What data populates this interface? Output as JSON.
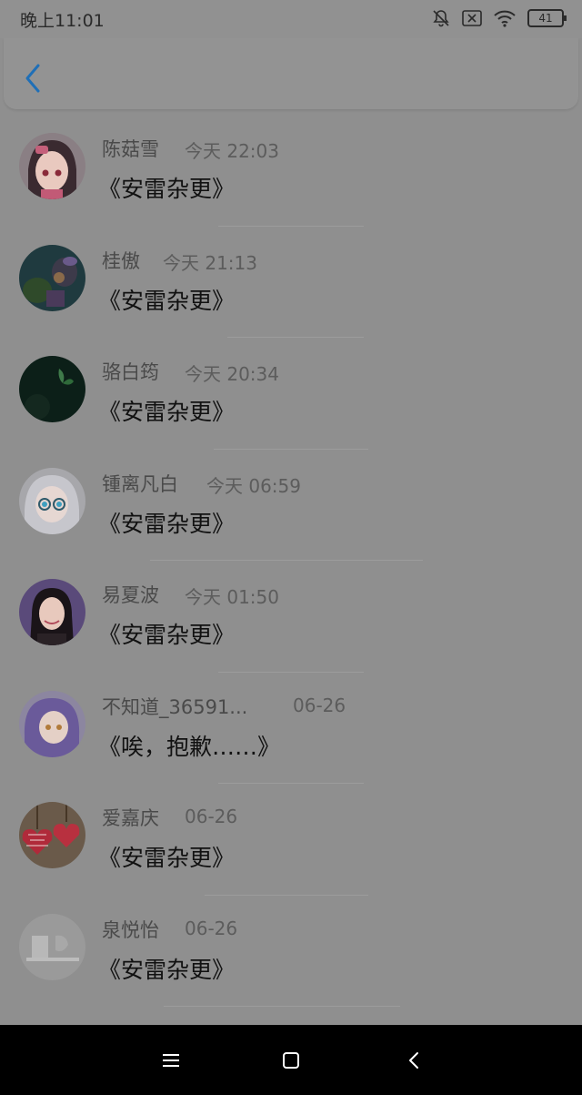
{
  "status_bar": {
    "time": "晚上11:01",
    "battery": "41",
    "icons": [
      "bell-off-icon",
      "sim-off-icon",
      "wifi-icon",
      "battery-icon"
    ]
  },
  "header": {
    "back_icon": "chevron-left-icon",
    "accent": "#1f6fb7"
  },
  "list": [
    {
      "name": "陈菇雪",
      "time": "今天 22:03",
      "title": "《安雷杂更》"
    },
    {
      "name": "桂傲",
      "time": "今天 21:13",
      "title": "《安雷杂更》"
    },
    {
      "name": "骆白筠",
      "time": "今天 20:34",
      "title": "《安雷杂更》"
    },
    {
      "name": "锺离凡白",
      "time": "今天 06:59",
      "title": "《安雷杂更》"
    },
    {
      "name": "易夏波",
      "time": "今天 01:50",
      "title": "《安雷杂更》"
    },
    {
      "name": "不知道_36591...",
      "time": "06-26",
      "title": "《唉，抱歉……》"
    },
    {
      "name": "爱嘉庆",
      "time": "06-26",
      "title": "《安雷杂更》"
    },
    {
      "name": "泉悦怡",
      "time": "06-26",
      "title": "《安雷杂更》"
    }
  ],
  "nav_bar": {
    "icons": [
      "menu-icon",
      "home-icon",
      "back-icon"
    ]
  }
}
